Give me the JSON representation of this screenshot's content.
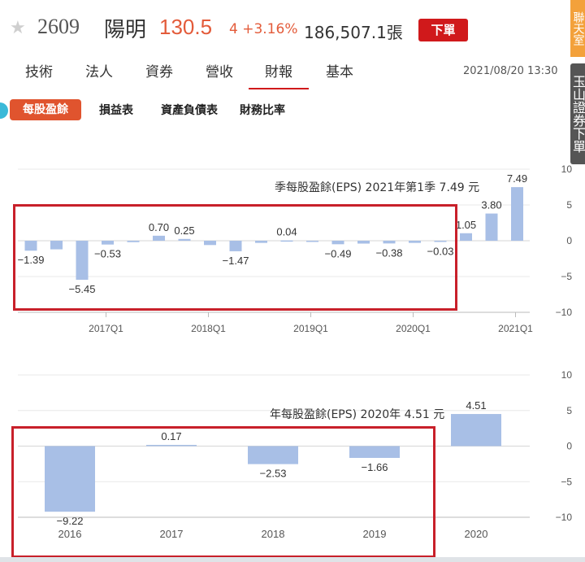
{
  "header": {
    "stock_code": "2609",
    "stock_name": "陽明",
    "price": "130.5",
    "change": "4 +3.16%",
    "volume": "186,507.1張",
    "order_button": "下單",
    "side_tab_a": "聯天室",
    "side_tab_b": "玉山證券下單"
  },
  "tabs": [
    "技術",
    "法人",
    "資券",
    "營收",
    "財報",
    "基本"
  ],
  "active_tab": "財報",
  "timestamp": "2021/08/20 13:30",
  "subtabs": {
    "active": "每股盈餘",
    "items": [
      "損益表",
      "資產負債表",
      "財務比率"
    ]
  },
  "colors": {
    "bar": "#a8bfe6",
    "accent_red": "#d0191b",
    "price_orange": "#e35b3a"
  },
  "chart_data": [
    {
      "type": "bar",
      "title": "季每股盈餘(EPS) 2021年第1季 7.49 元",
      "x_ticks": [
        "2017Q1",
        "2018Q1",
        "2019Q1",
        "2020Q1",
        "2021Q1"
      ],
      "values": [
        -1.39,
        -1.2,
        -5.45,
        -0.53,
        -0.2,
        0.7,
        0.25,
        -0.6,
        -1.47,
        -0.3,
        0.04,
        -0.1,
        -0.49,
        -0.4,
        -0.38,
        -0.3,
        -0.03,
        1.05,
        3.8,
        7.49
      ],
      "labels": [
        "-1.39",
        "",
        "-5.45",
        "-0.53",
        "",
        "0.70",
        "0.25",
        "",
        "-1.47",
        "",
        "0.04",
        "",
        "-0.49",
        "",
        "-0.38",
        "",
        "-0.03",
        "1.05",
        "3.80",
        "7.49"
      ],
      "ylim": [
        -10,
        10
      ],
      "y_ticks": [
        "10",
        "5",
        "0",
        "-5",
        "-10"
      ]
    },
    {
      "type": "bar",
      "title": "年每股盈餘(EPS) 2020年 4.51 元",
      "categories": [
        "2016",
        "2017",
        "2018",
        "2019",
        "2020"
      ],
      "values": [
        -9.22,
        0.17,
        -2.53,
        -1.66,
        4.51
      ],
      "labels": [
        "-9.22",
        "0.17",
        "-2.53",
        "-1.66",
        "4.51"
      ],
      "ylim": [
        -10,
        10
      ],
      "y_ticks": [
        "10",
        "5",
        "0",
        "-5",
        "-10"
      ]
    }
  ]
}
